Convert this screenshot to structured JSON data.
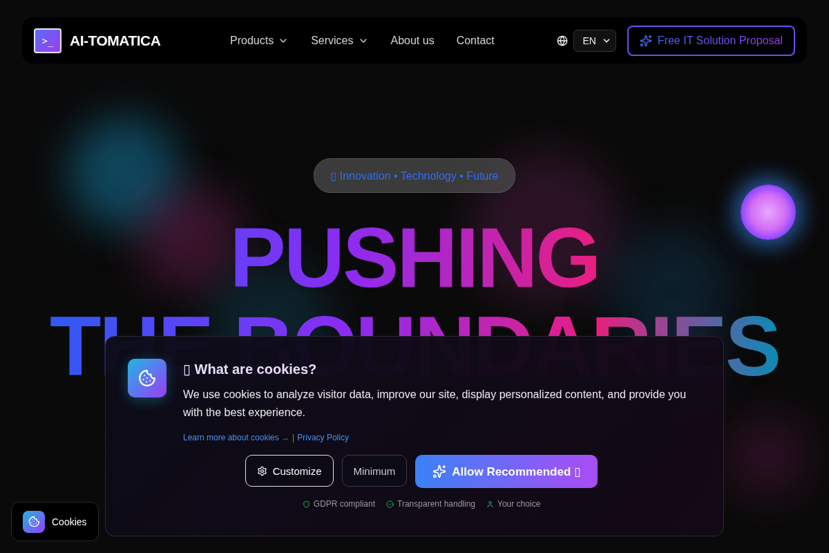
{
  "nav": {
    "brand": "AI-TOMATICA",
    "logo_glyph": ">_",
    "links": [
      {
        "label": "Products",
        "dropdown": true
      },
      {
        "label": "Services",
        "dropdown": true
      },
      {
        "label": "About us",
        "dropdown": false
      },
      {
        "label": "Contact",
        "dropdown": false
      }
    ],
    "language": "EN",
    "cta": "Free IT Solution Proposal"
  },
  "hero": {
    "badge": "▯ Innovation • Technology • Future",
    "lines": [
      "PUSHING",
      "THE BOUNDARIES"
    ]
  },
  "cookie_dialog": {
    "title": "▯ What are cookies?",
    "text": "We use cookies to analyze visitor data, improve our site, display personalized content, and provide you with the best experience.",
    "links": [
      "Learn more about cookies →",
      "Privacy Policy"
    ],
    "separator": "|",
    "buttons": [
      {
        "label": "Customize",
        "kind": "outline"
      },
      {
        "label": "Minimum",
        "kind": "ghost"
      },
      {
        "label": "Allow Recommended ▯",
        "kind": "primary"
      }
    ],
    "badges": [
      {
        "label": "GDPR compliant",
        "kind": "shield"
      },
      {
        "label": "Transparent handling",
        "kind": "check"
      },
      {
        "label": "Your choice",
        "kind": "user"
      }
    ]
  },
  "cookie_pill": {
    "label": "Cookies"
  }
}
